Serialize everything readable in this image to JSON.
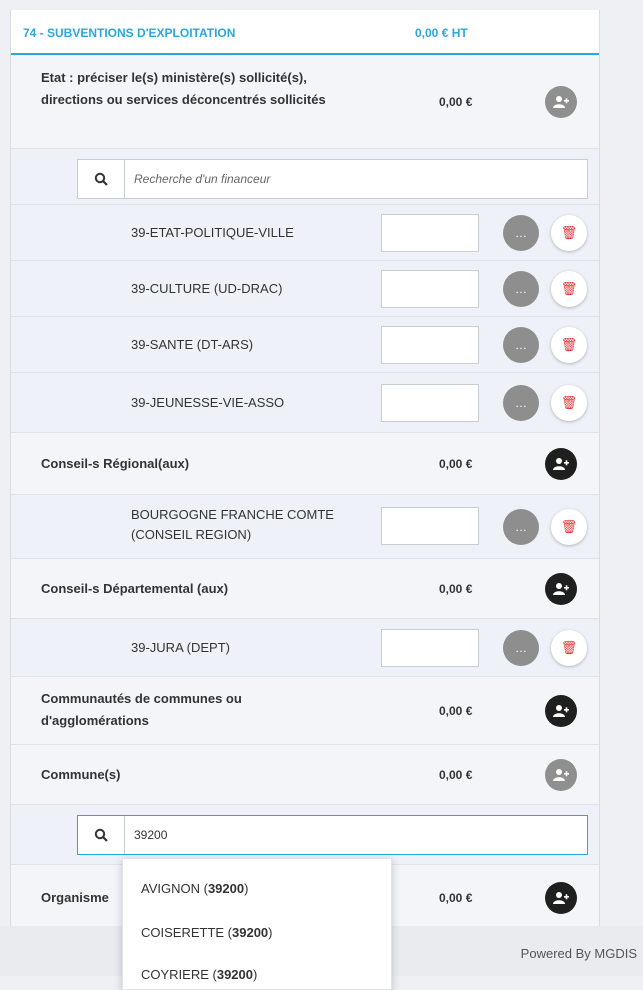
{
  "header": {
    "title": "74 - SUBVENTIONS D'EXPLOITATION",
    "amount": "0,00 € HT"
  },
  "categories": {
    "etat": {
      "label": "Etat : préciser le(s) ministère(s) sollicité(s), directions ou services déconcentrés sollicités",
      "amount": "0,00 €"
    },
    "region": {
      "label": "Conseil-s Régional(aux)",
      "amount": "0,00 €"
    },
    "departement": {
      "label": "Conseil-s Départemental (aux)",
      "amount": "0,00 €"
    },
    "communautes": {
      "label": "Communautés de communes ou d'agglomérations",
      "amount": "0,00 €"
    },
    "communes": {
      "label": "Commune(s)",
      "amount": "0,00 €"
    },
    "organismes": {
      "label": "Organisme",
      "amount": "0,00 €"
    }
  },
  "search_etat": {
    "placeholder": "Recherche d'un financeur"
  },
  "search_communes": {
    "value": "39200"
  },
  "financeurs": {
    "f1": "39-ETAT-POLITIQUE-VILLE",
    "f2": "39-CULTURE (UD-DRAC)",
    "f3": "39-SANTE (DT-ARS)",
    "f4": "39-JEUNESSE-VIE-ASSO",
    "f5_line1": "BOURGOGNE FRANCHE COMTE",
    "f5_line2": "(CONSEIL REGION)",
    "f6": "39-JURA (DEPT)"
  },
  "dropdown": [
    {
      "name": "AVIGNON (",
      "code": "39200",
      "close": ")"
    },
    {
      "name": "COISERETTE (",
      "code": "39200",
      "close": ")"
    },
    {
      "name": "COYRIERE (",
      "code": "39200",
      "close": ")"
    }
  ],
  "footer": {
    "powered": "Powered By MGDIS"
  },
  "icons": {
    "add": "add-person-icon",
    "comment": "comment-icon",
    "delete": "trash-icon",
    "search": "search-icon"
  },
  "colors": {
    "accent": "#2aa7dc",
    "danger": "#e03a3a",
    "dark_button": "#1f1f1f",
    "grey_button": "#8f8f8f"
  }
}
